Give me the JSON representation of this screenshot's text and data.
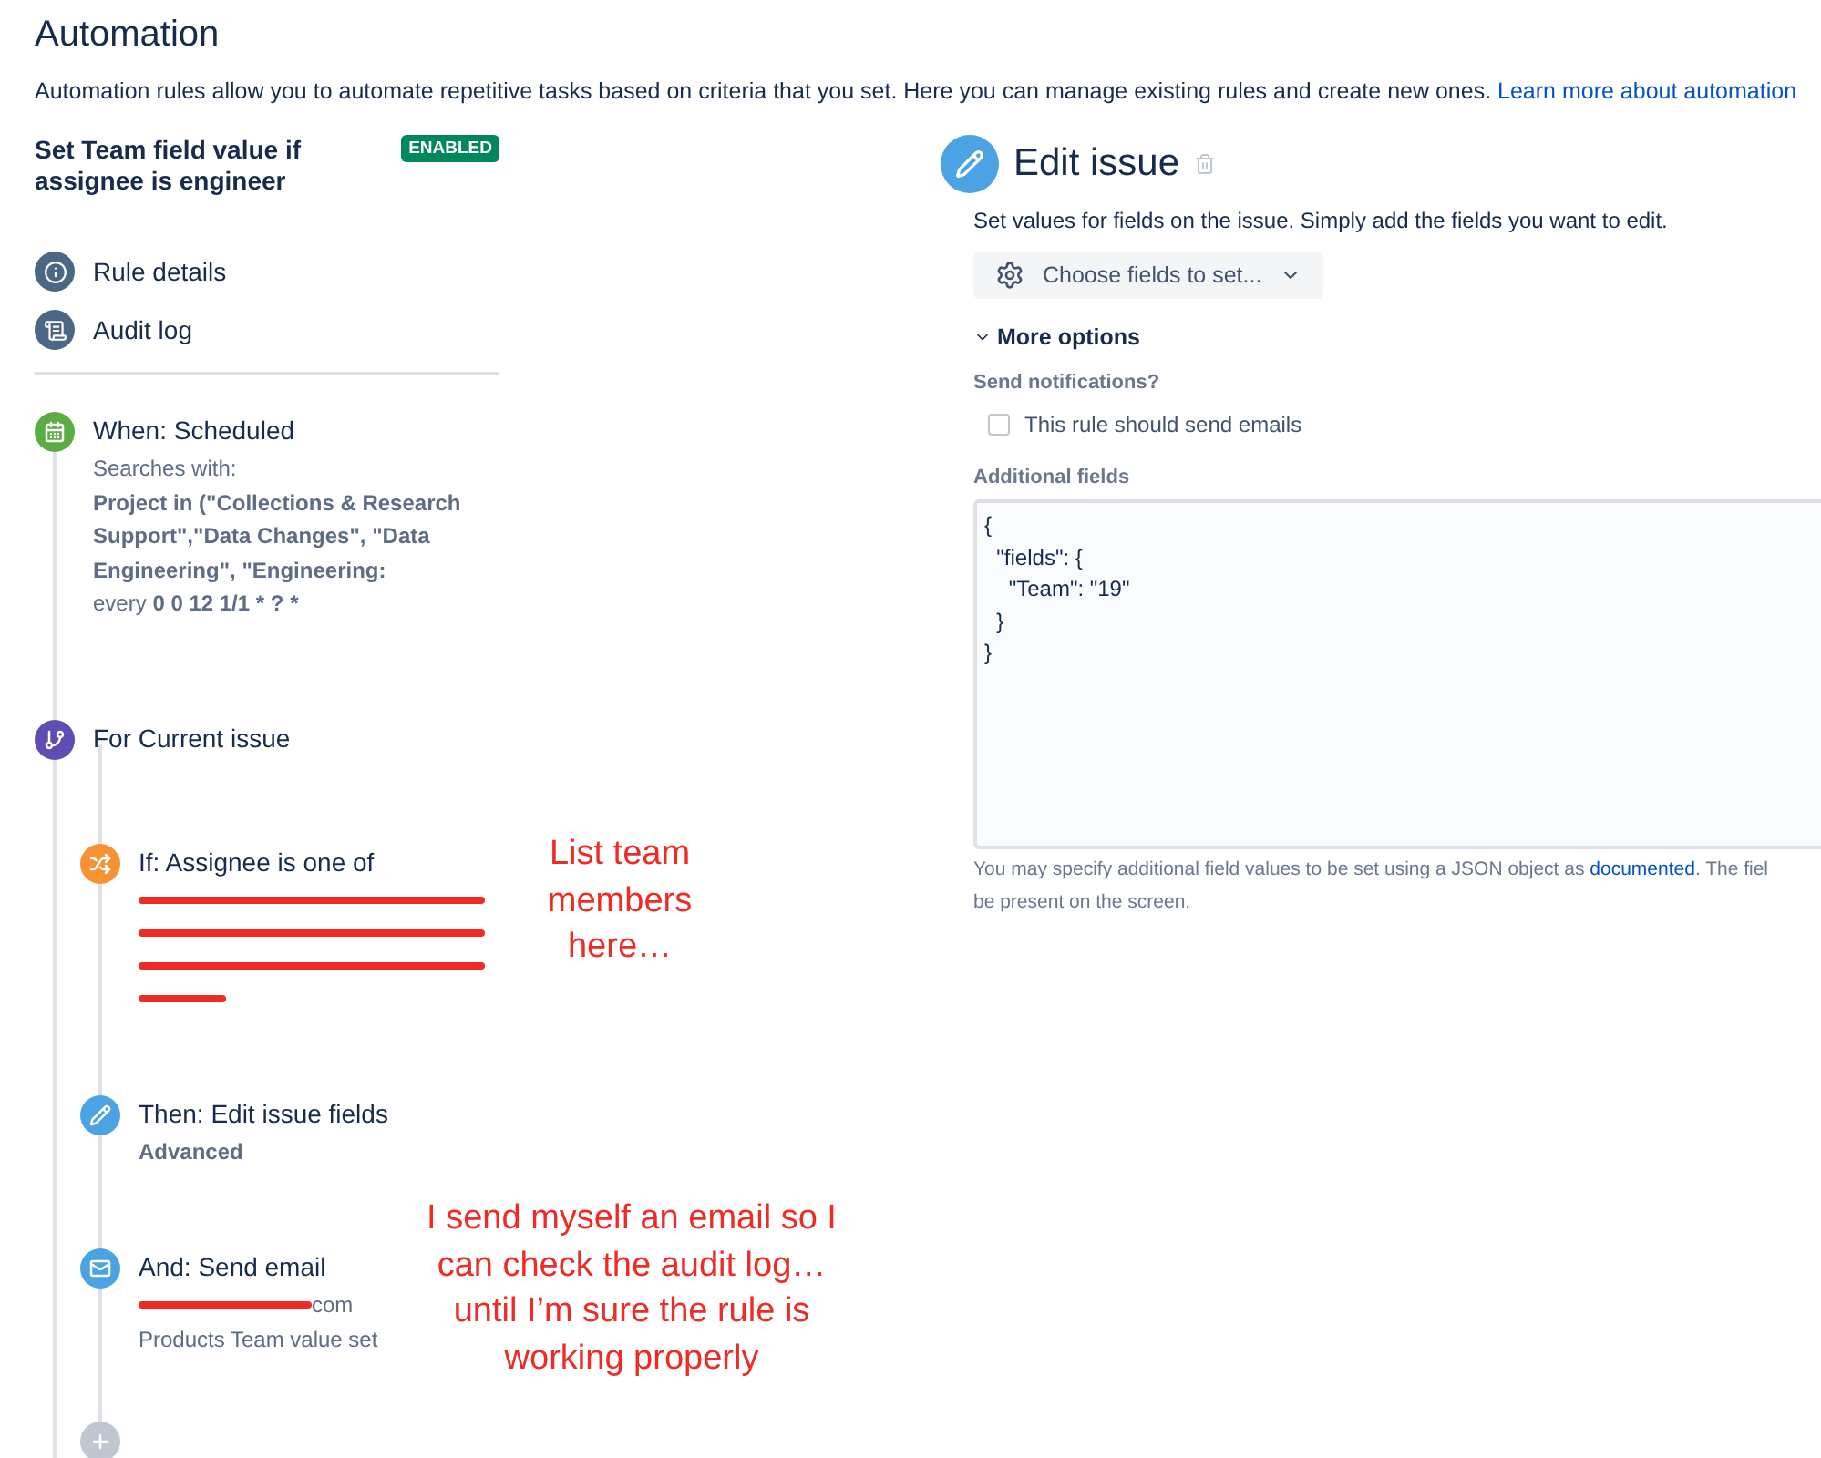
{
  "page": {
    "title": "Automation",
    "description": "Automation rules allow you to automate repetitive tasks based on criteria that you set. Here you can manage existing rules and create new ones. ",
    "description_link": "Learn more about automation"
  },
  "rule": {
    "name": "Set Team field value if assignee is engineer",
    "status": "ENABLED",
    "enabled": true
  },
  "nav": [
    {
      "label": "Rule details"
    },
    {
      "label": "Audit log"
    }
  ],
  "steps": [
    {
      "kind": "when",
      "title": "When: Scheduled",
      "color": "#5aac44",
      "details": [
        [
          {
            "text": "Searches with:"
          }
        ],
        [
          {
            "text": "Project in (\"Collections & Research Support\",\"Data Changes\", \"Data Engineering\", \"Engineering:",
            "bold": true
          }
        ],
        [
          {
            "text": "every "
          },
          {
            "text": "0 0 12 1/1 * ? *",
            "bold": true
          }
        ]
      ]
    },
    {
      "kind": "for",
      "title": "For Current issue",
      "color": "#5e4db2"
    },
    {
      "kind": "if",
      "title": "If: Assignee is one of",
      "color": "#f79232",
      "redacted": true
    },
    {
      "kind": "then",
      "title": "Then: Edit issue fields",
      "color": "#4ba3e3",
      "details": [
        [
          {
            "text": "Advanced",
            "bold": true
          }
        ]
      ]
    },
    {
      "kind": "and",
      "title": "And: Send email",
      "color": "#4ba3e3",
      "redacted_prefix": true,
      "details": [
        [
          {
            "text": "com"
          }
        ],
        [
          {
            "text": "Products Team value set"
          }
        ]
      ]
    },
    {
      "kind": "add",
      "color": "#c1c7d0"
    }
  ],
  "annotations": [
    "List team members here…",
    "I send myself an email so I can check the audit log… until I’m sure the rule is working properly"
  ],
  "editor": {
    "title": "Edit issue",
    "description": "Set values for fields on the issue. Simply add the fields you want to edit.",
    "choose_button": "Choose fields to set...",
    "more_options": {
      "label": "More options",
      "expanded": true
    },
    "notifications_label": "Send notifications?",
    "send_emails": {
      "label": "This rule should send emails",
      "checked": false
    },
    "additional_label": "Additional fields",
    "additional_value": "{\n  \"fields\": {\n    \"Team\": \"19\"\n  }\n}",
    "help_before": "You may specify additional field values to be set using a JSON object as ",
    "help_link": "documented",
    "help_after": ". The fiel",
    "help_line2": "be present on the screen."
  }
}
